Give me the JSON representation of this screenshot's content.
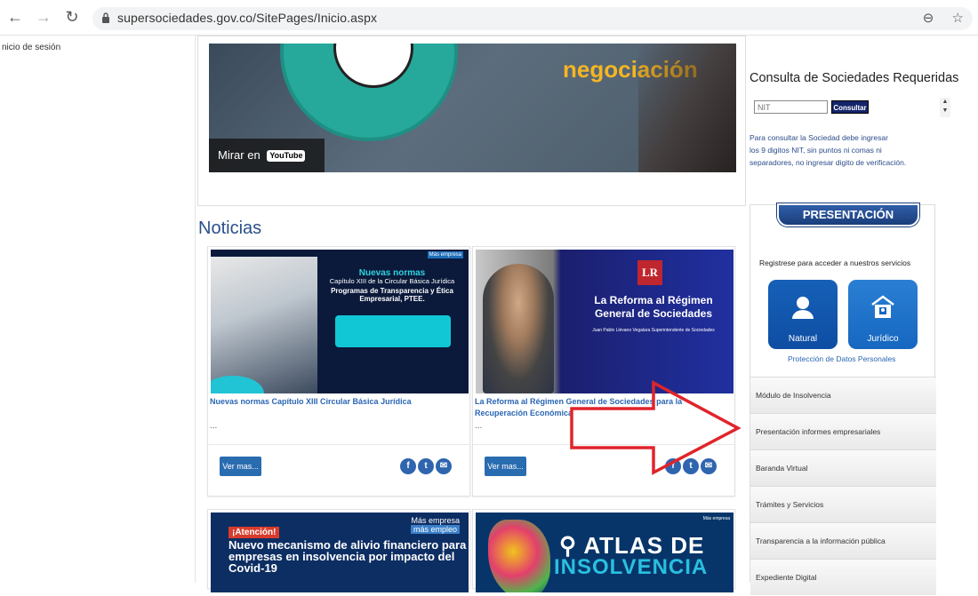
{
  "browser": {
    "url": "supersociedades.gov.co/SitePages/Inicio.aspx",
    "back_icon": "back-arrow-icon",
    "forward_icon": "forward-arrow-icon",
    "reload_icon": "reload-icon"
  },
  "left_rail": {
    "login_text": "nicio de sesión"
  },
  "video": {
    "headline": "negociación",
    "watch_label": "Mirar en",
    "youtube_label": "YouTube"
  },
  "news_section": {
    "title": "Noticias",
    "cards": [
      {
        "image_tag": "Más empresa",
        "image_heading": "Nuevas normas",
        "image_subheading": "Capítulo XIII de la Circular Básica Jurídica",
        "image_program": "Programas de Transparencia y Ética Empresarial, PTEE.",
        "title": "Nuevas normas Capítulo XIII Circular Básica Jurídica",
        "excerpt": "...",
        "button": "Ver mas..."
      },
      {
        "image_logo": "LR",
        "image_heading": "La Reforma al Régimen General de Sociedades",
        "image_byline": "Juan Pablo Liévano Vegalara Superintendente de Sociedades",
        "title": "La Reforma al Régimen General de Sociedades para la Recuperación Económica",
        "excerpt": "...",
        "button": "Ver mas..."
      },
      {
        "image_alert": "¡Atención!",
        "image_heading": "Nuevo mecanismo de alivio financiero para empresas en insolvencia por impacto del Covid-19",
        "image_tag_1": "Más empresa",
        "image_tag_2": "más empleo"
      },
      {
        "image_heading_1": "ATLAS DE",
        "image_heading_2": "INSOLVENCIA",
        "image_tag": "Más empresa"
      }
    ]
  },
  "consulta": {
    "title": "Consulta de Sociedades Requeridas",
    "nit_placeholder": "NIT",
    "button": "Consultar",
    "help_line_1": "Para consultar la Sociedad debe ingresar",
    "help_line_2": "los 9 digitos NIT,  sin puntos ni comas ni",
    "help_line_3": "separadores, no ingresar digito de verificación."
  },
  "presentacion": {
    "tab_label": "PRESENTACIÓN",
    "register_text": "Registrese para acceder a nuestros servicios",
    "natural_label": "Natural",
    "juridico_label": "Jurídico",
    "privacy_link": "Protección de Datos Personales"
  },
  "menu": [
    "Módulo de Insolvencia",
    "Presentación informes empresariales",
    "Baranda Virtual",
    "Trámites y Servicios",
    "Transparencia a la información pública",
    "Expediente Digital"
  ],
  "colors": {
    "accent_blue": "#2a6cb0",
    "heading_blue": "#2a4f8a",
    "annotation_red": "#e0242b"
  }
}
